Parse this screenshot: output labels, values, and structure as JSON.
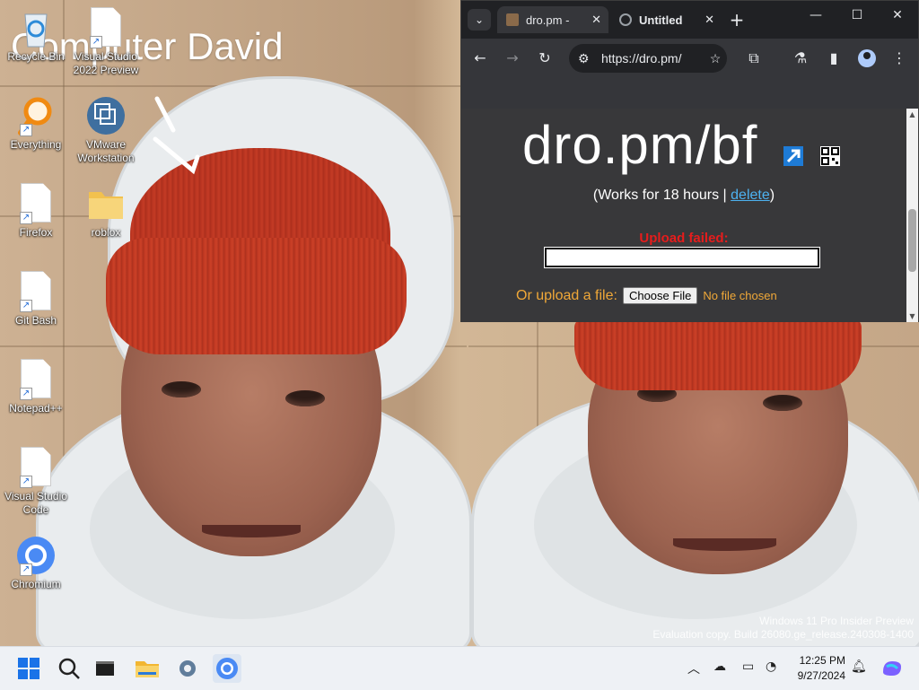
{
  "wallpaper": {
    "title_text": "Computer David"
  },
  "desktop_icons": [
    {
      "name": "recycle-bin",
      "label": "Recycle Bin",
      "icon": "recycle-bin-icon"
    },
    {
      "name": "visual-studio-2022",
      "label": "Visual Studio 2022 Preview",
      "icon": "file-icon"
    },
    {
      "name": "everything",
      "label": "Everything",
      "icon": "magnifier-icon"
    },
    {
      "name": "vmware",
      "label": "VMware Workstation",
      "icon": "vmware-icon"
    },
    {
      "name": "firefox",
      "label": "Firefox",
      "icon": "file-icon"
    },
    {
      "name": "roblox",
      "label": "roblox",
      "icon": "folder-icon"
    },
    {
      "name": "git-bash",
      "label": "Git Bash",
      "icon": "file-icon"
    },
    {
      "name": "notepadpp",
      "label": "Notepad++",
      "icon": "file-icon"
    },
    {
      "name": "vscode",
      "label": "Visual Studio Code",
      "icon": "file-icon"
    },
    {
      "name": "chromium",
      "label": "Chromium",
      "icon": "chromium-icon"
    }
  ],
  "browser": {
    "tabs": [
      {
        "title": "dro.pm - ",
        "active": true
      },
      {
        "title": "Untitled",
        "active": false
      }
    ],
    "new_tab_symbol": "+",
    "url": "https://dro.pm/",
    "page": {
      "heading": "dro.pm/bf",
      "works_prefix": "(Works for 18 hours | ",
      "delete_link": "delete",
      "works_suffix": ")",
      "upload_failed": "Upload failed:",
      "text_value": "",
      "upload_label": "Or upload a file:",
      "choose_button": "Choose File",
      "no_file": "No file chosen"
    }
  },
  "watermark": {
    "line1": "Windows 11 Pro Insider Preview",
    "line2": "Evaluation copy. Build 26080.ge_release.240308-1400"
  },
  "taskbar": {
    "apps": [
      "start-icon",
      "search-icon",
      "terminal-icon",
      "file-explorer-icon",
      "settings-icon",
      "chromium-icon"
    ],
    "time": "12:25 PM",
    "date": "9/27/2024"
  },
  "colors": {
    "browser_bg": "#202124",
    "page_bg": "#38383a",
    "upload_failed": "#e61c1c",
    "accent_orange": "#f0a838",
    "link": "#4db2f0"
  }
}
